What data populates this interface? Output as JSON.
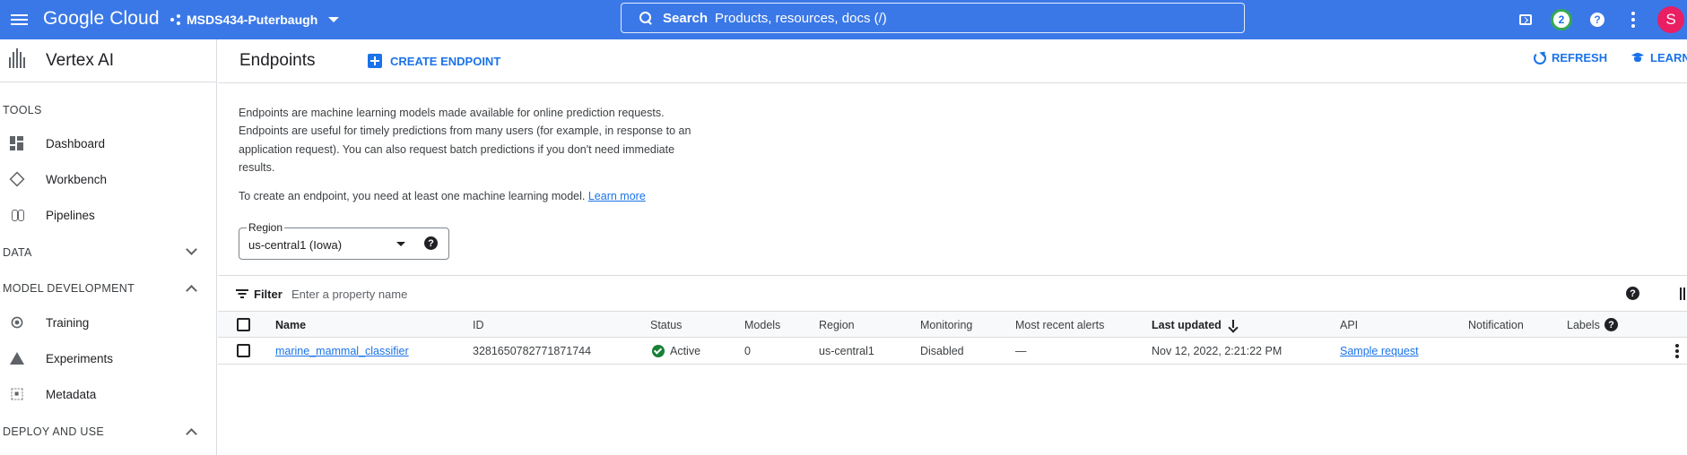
{
  "topbar": {
    "brand": "Google Cloud",
    "project": "MSDS434-Puterbaugh",
    "search_label": "Search",
    "search_placeholder": "Products, resources, docs (/)",
    "notifications_count": "2",
    "help_glyph": "?",
    "avatar_letter": "S",
    "icons": [
      "menu-icon",
      "project-icon",
      "search-icon",
      "cloud-shell-icon",
      "help-icon",
      "more-vert-icon"
    ]
  },
  "sidebar": {
    "product": "Vertex AI",
    "sections": {
      "tools": "TOOLS",
      "data": "DATA",
      "model_development": "MODEL DEVELOPMENT",
      "deploy_and_use": "DEPLOY AND USE"
    },
    "tools_items": [
      "Dashboard",
      "Workbench",
      "Pipelines"
    ],
    "model_dev_items": [
      "Training",
      "Experiments",
      "Metadata"
    ]
  },
  "header": {
    "title": "Endpoints",
    "create_label": "CREATE ENDPOINT",
    "refresh_label": "REFRESH",
    "learn_label": "LEARN"
  },
  "content": {
    "description": "Endpoints are machine learning models made available for online prediction requests. Endpoints are useful for timely predictions from many users (for example, in response to an application request). You can also request batch predictions if you don't need immediate results.",
    "create_hint": "To create an endpoint, you need at least one machine learning model.",
    "learn_more": "Learn more",
    "region_label": "Region",
    "region_value": "us-central1 (Iowa)",
    "help_glyph": "?"
  },
  "filter": {
    "label": "Filter",
    "placeholder": "Enter a property name"
  },
  "table": {
    "columns": [
      "Name",
      "ID",
      "Status",
      "Models",
      "Region",
      "Monitoring",
      "Most recent alerts",
      "Last updated",
      "API",
      "Notification",
      "Labels"
    ],
    "rows": [
      {
        "name": "marine_mammal_classifier",
        "id": "3281650782771871744",
        "status": "Active",
        "models": "0",
        "region": "us-central1",
        "monitoring": "Disabled",
        "alerts": "—",
        "last_updated": "Nov 12, 2022, 2:21:22 PM",
        "api": "Sample request",
        "notification": "",
        "labels": ""
      }
    ]
  },
  "colors": {
    "topbar": "#3b78e7",
    "accent": "#1a73e8",
    "active_status": "#188038",
    "avatar": "#e91e63"
  }
}
